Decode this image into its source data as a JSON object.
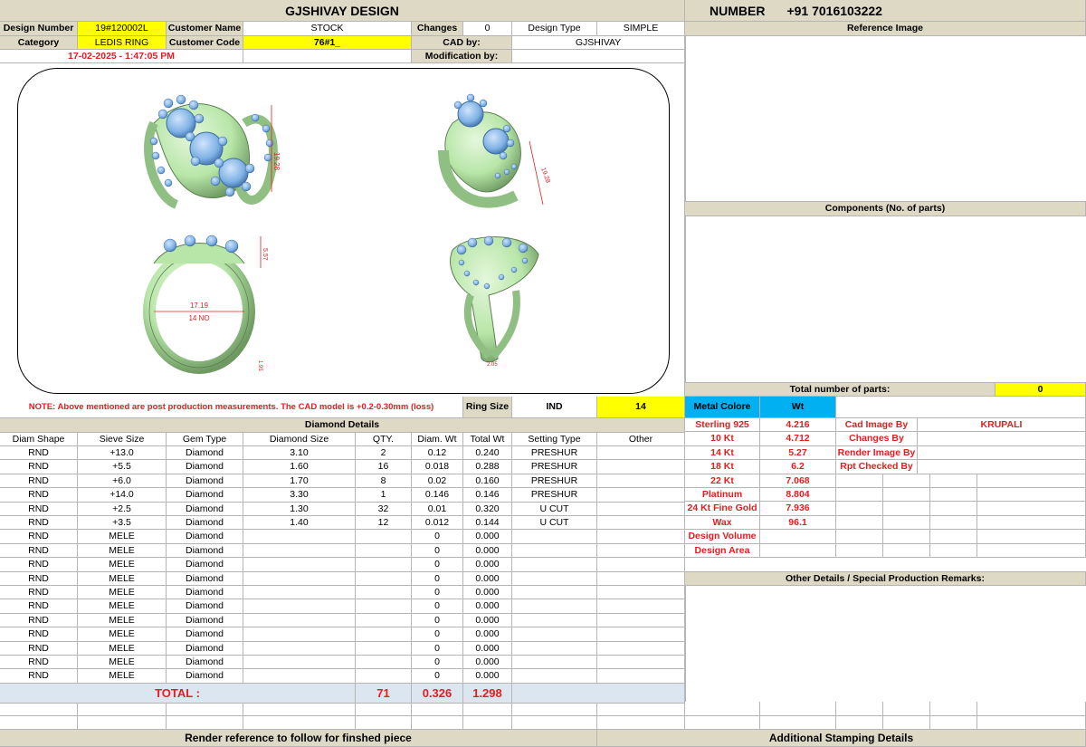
{
  "title": "GJSHIVAY DESIGN",
  "number_label": "NUMBER",
  "number_value": "+91 7016103222",
  "header": {
    "design_number_label": "Design Number",
    "design_number": "19#120002L",
    "customer_name_label": "Customer Name",
    "customer_name": "STOCK",
    "changes_label": "Changes",
    "changes": "0",
    "design_type_label": "Design Type",
    "design_type": "SIMPLE",
    "category_label": "Category",
    "category": "LEDIS RING",
    "customer_code_label": "Customer Code",
    "customer_code": "76#1_",
    "cad_by_label": "CAD by:",
    "cad_by": "GJSHIVAY",
    "timestamp": "17-02-2025 - 1:47:05 PM",
    "modification_label": "Modification by:",
    "modification": ""
  },
  "right_panel": {
    "reference_image": "Reference Image",
    "components": "Components (No. of parts)",
    "total_parts_label": "Total number of parts:",
    "total_parts": "0"
  },
  "dimensions": {
    "top_height": "19.28",
    "side_height": "5.57",
    "inner_diameter": "17.19",
    "ring_no": "14 NO",
    "shank_a": "1.95",
    "shank_b": "2.05"
  },
  "note": "NOTE: Above mentioned are post production measurements. The CAD model is +0.2-0.30mm (loss)",
  "ring_size_label": "Ring Size",
  "ring_size_std": "IND",
  "ring_size": "14",
  "diamond_details_title": "Diamond Details",
  "diamond_columns": [
    "Diam Shape",
    "Sieve Size",
    "Gem Type",
    "Diamond Size",
    "QTY.",
    "Diam. Wt",
    "Total Wt",
    "Setting Type",
    "Other"
  ],
  "diamonds": [
    [
      "RND",
      "+13.0",
      "Diamond",
      "3.10",
      "2",
      "0.12",
      "0.240",
      "PRESHUR",
      ""
    ],
    [
      "RND",
      "+5.5",
      "Diamond",
      "1.60",
      "16",
      "0.018",
      "0.288",
      "PRESHUR",
      ""
    ],
    [
      "RND",
      "+6.0",
      "Diamond",
      "1.70",
      "8",
      "0.02",
      "0.160",
      "PRESHUR",
      ""
    ],
    [
      "RND",
      "+14.0",
      "Diamond",
      "3.30",
      "1",
      "0.146",
      "0.146",
      "PRESHUR",
      ""
    ],
    [
      "RND",
      "+2.5",
      "Diamond",
      "1.30",
      "32",
      "0.01",
      "0.320",
      "U CUT",
      ""
    ],
    [
      "RND",
      "+3.5",
      "Diamond",
      "1.40",
      "12",
      "0.012",
      "0.144",
      "U CUT",
      ""
    ],
    [
      "RND",
      "MELE",
      "Diamond",
      "",
      "",
      "0",
      "0.000",
      "",
      ""
    ],
    [
      "RND",
      "MELE",
      "Diamond",
      "",
      "",
      "0",
      "0.000",
      "",
      ""
    ],
    [
      "RND",
      "MELE",
      "Diamond",
      "",
      "",
      "0",
      "0.000",
      "",
      ""
    ],
    [
      "RND",
      "MELE",
      "Diamond",
      "",
      "",
      "0",
      "0.000",
      "",
      ""
    ],
    [
      "RND",
      "MELE",
      "Diamond",
      "",
      "",
      "0",
      "0.000",
      "",
      ""
    ],
    [
      "RND",
      "MELE",
      "Diamond",
      "",
      "",
      "0",
      "0.000",
      "",
      ""
    ],
    [
      "RND",
      "MELE",
      "Diamond",
      "",
      "",
      "0",
      "0.000",
      "",
      ""
    ],
    [
      "RND",
      "MELE",
      "Diamond",
      "",
      "",
      "0",
      "0.000",
      "",
      ""
    ],
    [
      "RND",
      "MELE",
      "Diamond",
      "",
      "",
      "0",
      "0.000",
      "",
      ""
    ],
    [
      "RND",
      "MELE",
      "Diamond",
      "",
      "",
      "0",
      "0.000",
      "",
      ""
    ],
    [
      "RND",
      "MELE",
      "Diamond",
      "",
      "",
      "0",
      "0.000",
      "",
      ""
    ]
  ],
  "total": {
    "label": "TOTAL :",
    "qty": "71",
    "diam_wt": "0.326",
    "total_wt": "1.298"
  },
  "metal_header": "Metal Colore",
  "wt_header": "Wt",
  "metals": [
    {
      "name": "Sterling 925",
      "wt": "4.216"
    },
    {
      "name": "10 Kt",
      "wt": "4.712"
    },
    {
      "name": "14 Kt",
      "wt": "5.27"
    },
    {
      "name": "18 Kt",
      "wt": "6.2"
    },
    {
      "name": "22 Kt",
      "wt": "7.068"
    },
    {
      "name": "Platinum",
      "wt": "8.804"
    },
    {
      "name": "24 Kt Fine Gold",
      "wt": "7.936"
    },
    {
      "name": "Wax",
      "wt": "96.1"
    },
    {
      "name": "Design Volume",
      "wt": ""
    },
    {
      "name": "Design Area",
      "wt": ""
    }
  ],
  "credits": [
    {
      "label": "Cad Image By",
      "value": "KRUPALI"
    },
    {
      "label": "Changes By",
      "value": ""
    },
    {
      "label": "Render Image By",
      "value": ""
    },
    {
      "label": "Rpt Checked By",
      "value": ""
    }
  ],
  "other_details": "Other Details / Special Production Remarks:",
  "render_reference": "Render reference to follow for finshed piece",
  "stamping": "Additional Stamping Details",
  "colors": {
    "header_bg": "#ddd9c4",
    "highlight": "#ffff00",
    "total_bg": "#dce6f1",
    "metal_header_bg": "#00b0f0",
    "red_text": "#e02020",
    "ring_metal": "#b8e6a8",
    "ring_stone": "#7fb2e5"
  }
}
